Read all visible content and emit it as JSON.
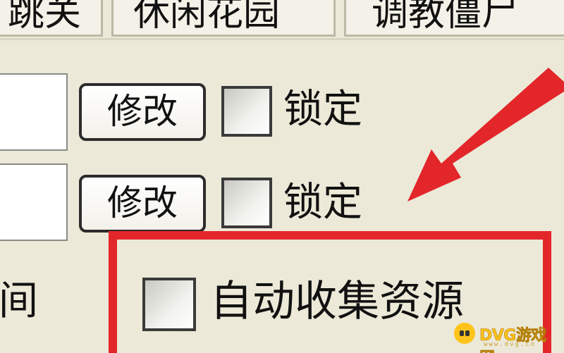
{
  "tabs": [
    {
      "label": "跳关"
    },
    {
      "label": "休闲花园"
    },
    {
      "label": "调教僵尸"
    }
  ],
  "rows": [
    {
      "button_label": "修改",
      "checkbox_label": "锁定",
      "checked": false
    },
    {
      "button_label": "修改",
      "checkbox_label": "锁定",
      "checked": false
    }
  ],
  "partial_label": "间",
  "auto_collect": {
    "label": "自动收集资源",
    "checked": false
  },
  "annotation": {
    "color": "#e3262a"
  },
  "watermark": {
    "title": "DVG游戏网",
    "subtitle": "www.dvg.cn"
  }
}
